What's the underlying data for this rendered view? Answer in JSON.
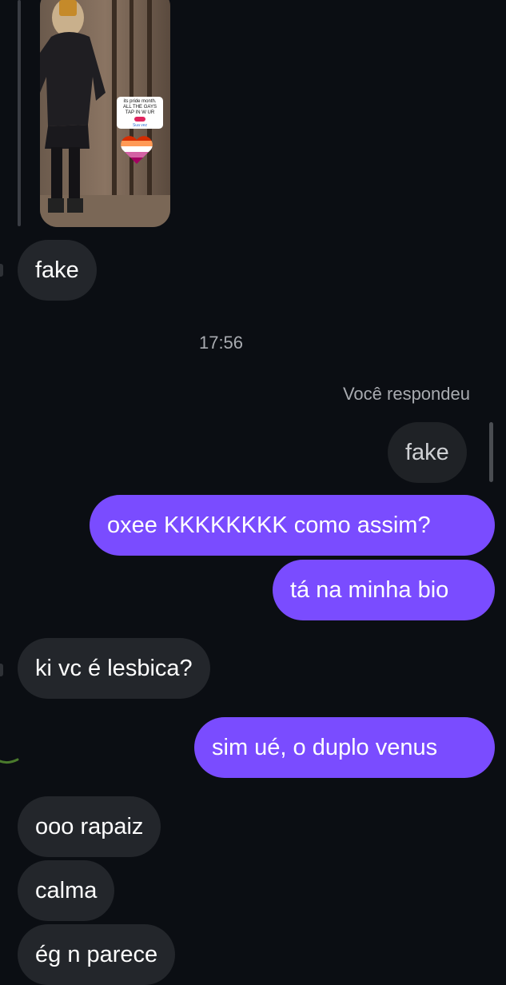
{
  "story": {
    "sticker_lines": [
      "its pride month.",
      "ALL THE GAYS",
      "TAP IN W UR"
    ],
    "sticker_footer": "Sua vez"
  },
  "messages": [
    {
      "id": "m1",
      "side": "in",
      "text": "fake"
    },
    {
      "id": "m2",
      "side": "out",
      "text": "oxee KKKKKKKK como assim?"
    },
    {
      "id": "m3",
      "side": "out",
      "text": "tá na minha bio"
    },
    {
      "id": "m4",
      "side": "in",
      "text": "ki vc é lesbica?"
    },
    {
      "id": "m5",
      "side": "out",
      "text": "sim ué, o duplo venus"
    },
    {
      "id": "m6",
      "side": "in",
      "text": "ooo rapaiz"
    },
    {
      "id": "m7",
      "side": "in",
      "text": "calma"
    },
    {
      "id": "m8",
      "side": "in",
      "text": "ég n parece"
    }
  ],
  "timestamp": "17:56",
  "reply": {
    "label": "Você respondeu",
    "quoted_text": "fake"
  },
  "colors": {
    "background": "#0b0e13",
    "incoming_bubble": "#23262b",
    "outgoing_bubble": "#7a4cff"
  }
}
